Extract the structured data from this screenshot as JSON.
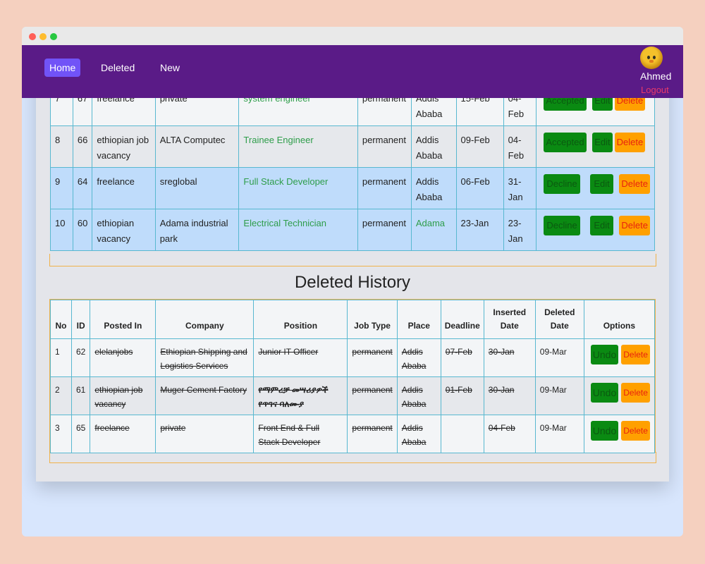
{
  "nav": {
    "items": [
      "Home",
      "Deleted",
      "New"
    ],
    "user": "Ahmed",
    "logout": "Logout"
  },
  "jobs": [
    {
      "no": "7",
      "id": "67",
      "posted_in": "freelance",
      "company": "private",
      "position": "system engineer",
      "job_type": "permanent",
      "place": "Addis Ababa",
      "deadline": "15-Feb",
      "inserted": "04-Feb",
      "status": "Accepted",
      "edit": "Edit",
      "delete": "Delete"
    },
    {
      "no": "8",
      "id": "66",
      "posted_in": "ethiopian job vacancy",
      "company": "ALTA Computec",
      "position": "Trainee Engineer",
      "job_type": "permanent",
      "place": "Addis Ababa",
      "deadline": "09-Feb",
      "inserted": "04-Feb",
      "status": "Accepted",
      "edit": "Edit",
      "delete": "Delete"
    },
    {
      "no": "9",
      "id": "64",
      "posted_in": "freelance",
      "company": "sreglobal",
      "position": "Full Stack Developer",
      "job_type": "permanent",
      "place": "Addis Ababa",
      "deadline": "06-Feb",
      "inserted": "31-Jan",
      "status": "Decline",
      "edit": "Edit",
      "delete": "Delete"
    },
    {
      "no": "10",
      "id": "60",
      "posted_in": "ethiopian vacancy",
      "company": "Adama industrial park",
      "position": "Electrical Technician",
      "job_type": "permanent",
      "place": "Adama",
      "deadline": "23-Jan",
      "inserted": "23-Jan",
      "status": "Decline",
      "edit": "Edit",
      "delete": "Delete"
    }
  ],
  "history": {
    "title": "Deleted History",
    "headers": [
      "No",
      "ID",
      "Posted In",
      "Company",
      "Position",
      "Job Type",
      "Place",
      "Deadline",
      "Inserted Date",
      "Deleted Date",
      "Options"
    ],
    "rows": [
      {
        "no": "1",
        "id": "62",
        "posted_in": "elelanjobs",
        "company": "Ethiopian Shipping and Logistics Services",
        "position": "Junior IT Officer",
        "job_type": "permanent",
        "place": "Addis Ababa",
        "deadline": "07-Feb",
        "inserted": "30-Jan",
        "deleted": "09-Mar",
        "undo": "Undo",
        "delete": "Delete"
      },
      {
        "no": "2",
        "id": "61",
        "posted_in": "ethiopian job vacancy",
        "company": "Muger Cement Factory",
        "position": "የማምረቻ መሣሪያዎች የጥገና ባለሙያ",
        "job_type": "permanent",
        "place": "Addis Ababa",
        "deadline": "01-Feb",
        "inserted": "30-Jan",
        "deleted": "09-Mar",
        "undo": "Undo",
        "delete": "Delete"
      },
      {
        "no": "3",
        "id": "65",
        "posted_in": "freelance",
        "company": "private",
        "position": "Front End & Full Stack Developer",
        "job_type": "permanent",
        "place": "Addis Ababa",
        "deadline": "",
        "inserted": "04-Feb",
        "deleted": "09-Mar",
        "undo": "Undo",
        "delete": "Delete"
      }
    ]
  },
  "colors": {
    "navbar": "#5a1b87",
    "active_nav": "#7153f7",
    "accepted": "#0a8a12",
    "delete": "#ffa000",
    "position_link": "#2e9d4a"
  }
}
